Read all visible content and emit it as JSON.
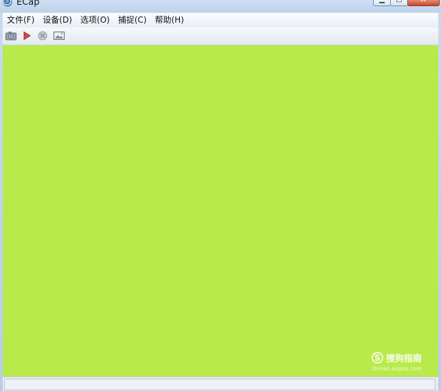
{
  "window": {
    "title": "ECap",
    "controls": {
      "minimize": "▁",
      "maximize": "▢",
      "close": "✕"
    }
  },
  "menu": [
    {
      "label": "文件(F)"
    },
    {
      "label": "设备(D)"
    },
    {
      "label": "选项(O)"
    },
    {
      "label": "捕捉(C)"
    },
    {
      "label": "帮助(H)"
    }
  ],
  "toolbar": {
    "icons": [
      "camera-icon",
      "play-icon",
      "stop-icon",
      "image-icon"
    ]
  },
  "content": {
    "background_color": "#b8ea4b"
  },
  "watermark": {
    "logo_letter": "S",
    "text": "搜狗指南",
    "url": "zhinan.sogou.com"
  },
  "status_bar": {
    "text": ""
  },
  "colors": {
    "accent": "#b8ea4b",
    "close_button": "#c8482a",
    "chrome": "#c9daf0"
  }
}
